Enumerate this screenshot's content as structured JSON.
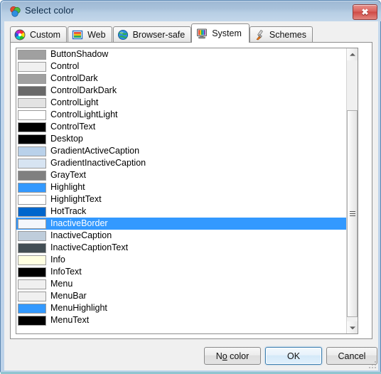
{
  "window": {
    "title": "Select color",
    "title_icon": "color-circles-icon",
    "close_label": "✖",
    "close_icon": "close-icon",
    "frame_color": "#bcd2e9",
    "titlebar_color": "#a8c1da"
  },
  "tabs": [
    {
      "label": "Custom",
      "icon": "color-wheel-icon",
      "selected": false
    },
    {
      "label": "Web",
      "icon": "web-palette-icon",
      "selected": false
    },
    {
      "label": "Browser-safe",
      "icon": "globe-icon",
      "selected": false
    },
    {
      "label": "System",
      "icon": "monitor-icon",
      "selected": true
    },
    {
      "label": "Schemes",
      "icon": "paintbrush-icon",
      "selected": false
    }
  ],
  "list": {
    "selected_index": 14,
    "items": [
      {
        "label": "ButtonShadow",
        "color": "#a0a0a0"
      },
      {
        "label": "Control",
        "color": "#f0f0f0"
      },
      {
        "label": "ControlDark",
        "color": "#a0a0a0"
      },
      {
        "label": "ControlDarkDark",
        "color": "#696969"
      },
      {
        "label": "ControlLight",
        "color": "#e3e3e3"
      },
      {
        "label": "ControlLightLight",
        "color": "#ffffff"
      },
      {
        "label": "ControlText",
        "color": "#000000"
      },
      {
        "label": "Desktop",
        "color": "#000000"
      },
      {
        "label": "GradientActiveCaption",
        "color": "#b9d1ea"
      },
      {
        "label": "GradientInactiveCaption",
        "color": "#d7e4f2"
      },
      {
        "label": "GrayText",
        "color": "#808080"
      },
      {
        "label": "Highlight",
        "color": "#3399ff"
      },
      {
        "label": "HighlightText",
        "color": "#ffffff"
      },
      {
        "label": "HotTrack",
        "color": "#0066cc"
      },
      {
        "label": "InactiveBorder",
        "color": "#f4f7fc"
      },
      {
        "label": "InactiveCaption",
        "color": "#bfcddb"
      },
      {
        "label": "InactiveCaptionText",
        "color": "#434e54"
      },
      {
        "label": "Info",
        "color": "#ffffe1"
      },
      {
        "label": "InfoText",
        "color": "#000000"
      },
      {
        "label": "Menu",
        "color": "#f0f0f0"
      },
      {
        "label": "MenuBar",
        "color": "#f0f0f0"
      },
      {
        "label": "MenuHighlight",
        "color": "#3399ff"
      },
      {
        "label": "MenuText",
        "color": "#000000"
      }
    ]
  },
  "scrollbar": {
    "up_arrow": "chevron-up-icon",
    "down_arrow": "chevron-down-icon"
  },
  "buttons": {
    "no_color": "No color",
    "no_color_accesskey": "o",
    "ok": "OK",
    "cancel": "Cancel",
    "default_button": "OK"
  },
  "colors": {
    "highlight": "#3399ff",
    "highlight_text": "#ffffff",
    "focus_border": "#3c7fb1"
  }
}
